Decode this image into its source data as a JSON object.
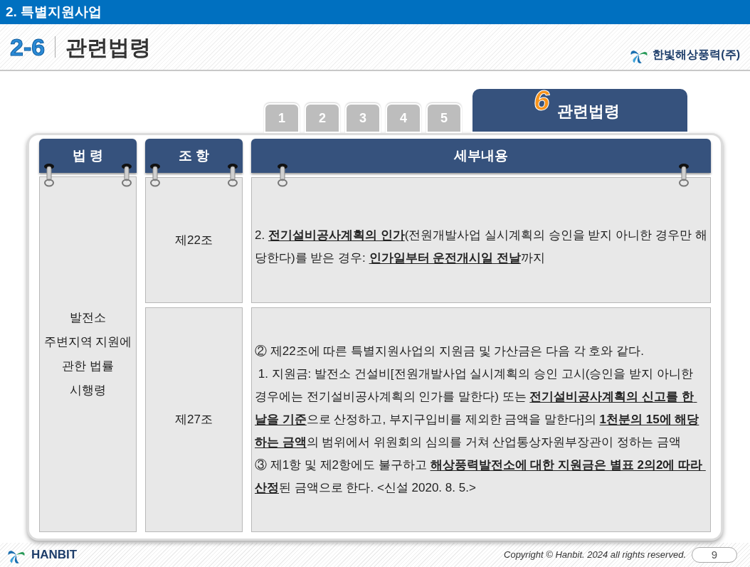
{
  "section_bar": {
    "title": "2. 특별지원사업"
  },
  "heading": {
    "number": "2-6",
    "title": "관련법령"
  },
  "company_logo": {
    "name": "한빛해상풍력(주)"
  },
  "tabs": [
    {
      "number": "1",
      "selected": false
    },
    {
      "number": "2",
      "selected": false
    },
    {
      "number": "3",
      "selected": false
    },
    {
      "number": "4",
      "selected": false
    },
    {
      "number": "5",
      "selected": false
    },
    {
      "number": "6",
      "label": "관련법령",
      "selected": true
    }
  ],
  "table": {
    "columns": [
      "법 령",
      "조 항",
      "세부내용"
    ],
    "law": [
      "발전소",
      "주변지역 지원에",
      "관한 법률",
      "시행령"
    ],
    "rows": [
      {
        "article": "제22조",
        "details": [
          "2. **전기설비공사계획의 인가**(전원개발사업 실시계획의 승인을 받지 아니한 경우만 해당한다)를 받은 경우: **인가일부터 운전개시일 전날**까지"
        ]
      },
      {
        "article": "제27조",
        "details": [
          "② 제22조에 따른 특별지원사업의 지원금 및 가산금은 다음 각 호와 같다.",
          " 1. 지원금: 발전소 건설비[전원개발사업 실시계획의 승인 고시(승인을 받지 아니한 경우에는 전기설비공사계획의 인가를 말한다) 또는 **전기설비공사계획의 신고를 한 날을 기준**으로 산정하고, 부지구입비를 제외한 금액을 말한다]의 **1천분의 15에 해당하는 금액**의 범위에서 위원회의 심의를 거쳐 산업통상자원부장관이 정하는 금액",
          "③ 제1항 및 제2항에도 불구하고 **해상풍력발전소에 대한 지원금은 별표 2의2에 따라 산정**된 금액으로 한다. <신설 2020. 8. 5.>"
        ]
      }
    ]
  },
  "footer": {
    "brand": "HANBIT",
    "copyright": "Copyright © Hanbit. 2024 all rights reserved.",
    "page": "9"
  }
}
